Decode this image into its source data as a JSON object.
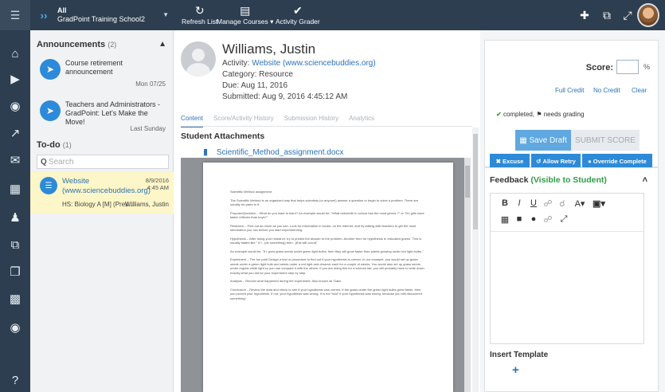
{
  "topbar": {
    "school_top": "All",
    "school_name": "GradPoint Training School2",
    "refresh_label": "Refresh List",
    "manage_label": "Manage Courses",
    "grader_label": "Activity Grader"
  },
  "announcements": {
    "title": "Announcements",
    "count": "(2)",
    "items": [
      {
        "title": "Course retirement announcement",
        "time": "Mon 07/25"
      },
      {
        "title": "Teachers and Administrators - GradPoint: Let's Make the Move!",
        "time": "Last Sunday"
      }
    ]
  },
  "todo": {
    "title": "To-do",
    "count": "(1)",
    "search_placeholder": "Search",
    "item": {
      "title": "Website (www.sciencebuddies.org)",
      "date": "8/9/2016",
      "time": "4:45 AM",
      "course": "HS: Biology A [M] (Pres...",
      "student": "Williams, Justin"
    }
  },
  "student": {
    "name": "Williams, Justin",
    "activity_prefix": "Activity:",
    "activity": "Website (www.sciencebuddies.org)",
    "category": "Category: Resource",
    "due": "Due: Aug 11, 2016",
    "submitted": "Submitted: Aug 9, 2016 4:45:12 AM"
  },
  "tabs": [
    "Content",
    "Score/Activity History",
    "Submission History",
    "Analytics"
  ],
  "attachments": {
    "title": "Student Attachments",
    "file": "Scientific_Method_assignment.docx"
  },
  "document": {
    "lines": [
      "Scientific Method assignment",
      "The Scientific Method is an organized way that helps scientists (or anyone!) answer a question or begin to solve a problem. There are usually six parts to it.",
      "Purpose/Question – What do you want to learn? An example would be, \"What does/milk in school has the most germs ?\" or \"Do girls have faster reflexes than boys?\"",
      "Research – Find out as much as you can. Look for information in books, on the internet, and by talking with teachers to get the most information you can before you start experimenting.",
      "Hypothesis – After doing your research, try to predict the answer to the problem. Another term for hypothesis is 'educated guess'. This is usually stated like \" If I...(do something) then...(this will occur)\"",
      "An example would be, \"If I grow grass seeds under green light bulbs, then they will grow faster than plants growing under red light bulbs.\"",
      "Experiment – The fun part! Design a test or procedure to find out if your hypothesis is correct. In our example, you would set up grass seeds under a green light bulb and seeds under a red light and observe each for a couple of weeks. You would also set up grass seeds under regular white light so you can compare it with the others. If you are doing this for a science fair, you will probably have to write down exactly what you did for your experiment step by step.",
      "Analysis – Record what happened during the experiment. Also known as 'Data'.",
      "Conclusion – Review the data and check to see if your hypothesis was correct. If the grass under the green light bulbs grew faster, then you proved your hypothesis. If not, your hypothesis was wrong. It is not \"bad\" if your hypothesis was wrong, because you still discovered something!"
    ]
  },
  "score": {
    "label": "Score:",
    "value": "",
    "suffix": "%",
    "full_credit": "Full Credit",
    "no_credit": "No Credit",
    "clear": "Clear",
    "status_completed": "completed,",
    "status_grading": "needs grading",
    "save_draft": "Save Draft",
    "submit": "SUBMIT SCORE",
    "excuse": "Excuse",
    "allow_retry": "Allow Retry",
    "override": "Override Complete"
  },
  "feedback": {
    "title": "Feedback",
    "visibility": "(Visible to Student)",
    "insert_template": "Insert Template"
  },
  "colors": {
    "topbar": "#2d3e50",
    "accent": "#2d8ad8",
    "link": "#2d73b8",
    "visible_green": "#2e9e45"
  }
}
